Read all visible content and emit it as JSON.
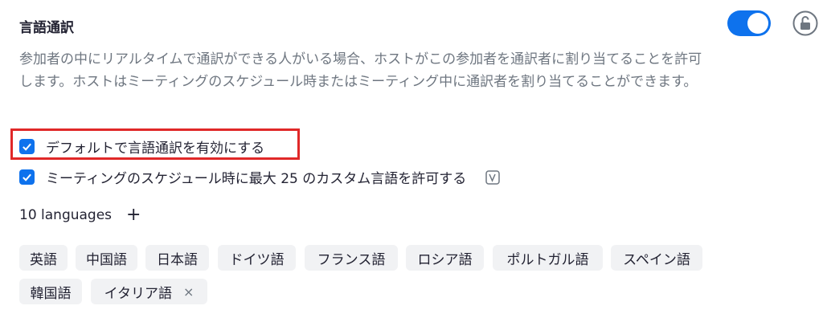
{
  "header": {
    "title": "言語通訳",
    "toggle_on": true,
    "lock_icon": "unlock-icon"
  },
  "description": "参加者の中にリアルタイムで通訳ができる人がいる場合、ホストがこの参加者を通訳者に割り当てることを許可します。ホストはミーティングのスケジュール時またはミーティング中に通訳者を割り当てることができます。",
  "options": [
    {
      "label": "デフォルトで言語通訳を有効にする",
      "checked": true
    },
    {
      "label": "ミーティングのスケジュール時に最大 25 のカスタム言語を許可する",
      "checked": true,
      "badge_icon": "version-badge-icon"
    }
  ],
  "languages": {
    "count_label": "10 languages",
    "add_label": "+",
    "items": [
      "英語",
      "中国語",
      "日本語",
      "ドイツ語",
      "フランス語",
      "ロシア語",
      "ポルトガル語",
      "スペイン語",
      "韓国語",
      "イタリア語"
    ],
    "remove_label": "×"
  },
  "colors": {
    "accent": "#0e72ed",
    "highlight": "#e02828",
    "chip_bg": "#f1f2f4"
  }
}
